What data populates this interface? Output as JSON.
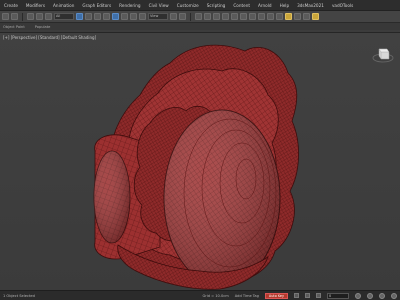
{
  "menubar": {
    "items": [
      "Create",
      "Modifiers",
      "Animation",
      "Graph Editors",
      "Rendering",
      "Civil View",
      "Customize",
      "Scripting",
      "Content",
      "Arnold",
      "Help",
      "3dsMax2021",
      "vadOTools"
    ]
  },
  "toolbar": {
    "selection_filter": "All",
    "view_dropdown": "View"
  },
  "ribbon": {
    "tabs": [
      "Object Paint",
      "Populate"
    ]
  },
  "viewport": {
    "label": "[+] [Perspective] [Standard] [Default Shading]",
    "mesh_color": "#9e3232",
    "wire_color": "#5a1414"
  },
  "status": {
    "left_text": "1 Object Selected",
    "grid": "Grid = 10.0cm",
    "add_time_tag": "Add Time Tag",
    "frame": "0",
    "key_label": "Auto Key"
  }
}
